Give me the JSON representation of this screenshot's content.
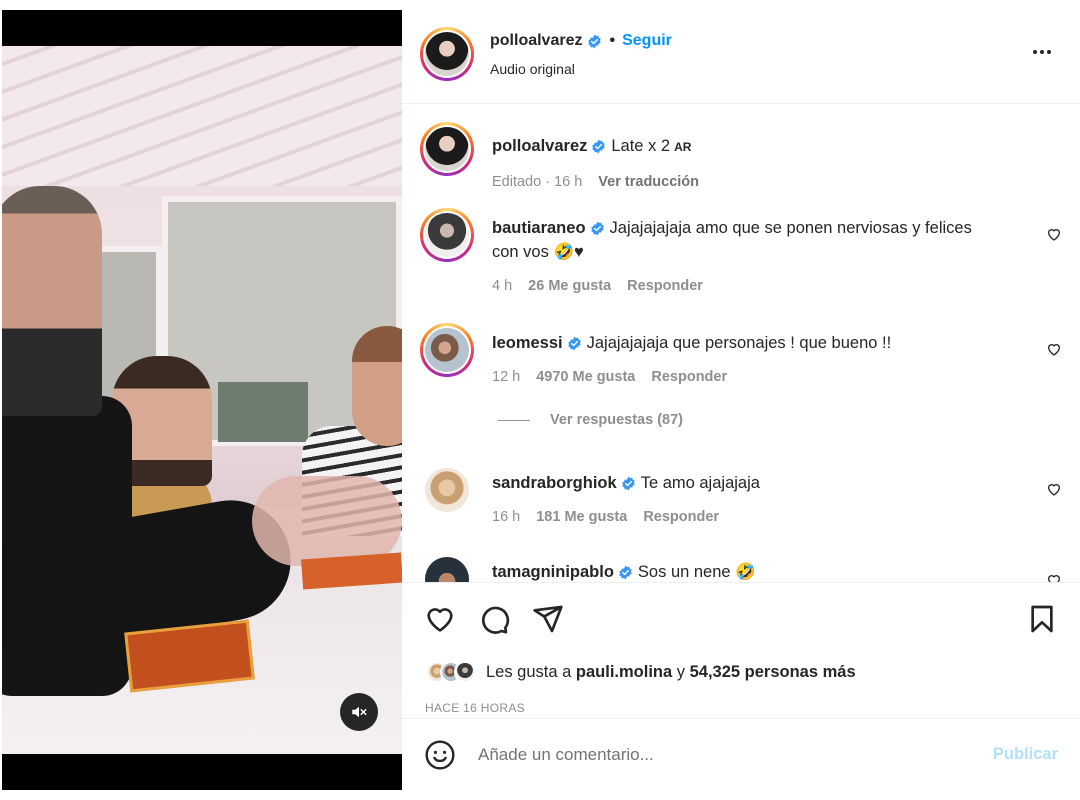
{
  "post": {
    "author": "polloalvarez",
    "follow_label": "Seguir",
    "separator": "•",
    "audio": "Audio original"
  },
  "caption": {
    "user": "polloalvarez",
    "text": "Late x 2",
    "tag": "AR",
    "edited": "Editado · 16 h",
    "translate": "Ver traducción"
  },
  "comments": [
    {
      "user": "bautiaraneo",
      "text": "Jajajajajaja amo que se ponen nerviosas y felices con vos 🤣♥",
      "time": "4 h",
      "likes": "26 Me gusta",
      "reply": "Responder"
    },
    {
      "user": "leomessi",
      "text": "Jajajajajaja que personajes ! que bueno !!",
      "time": "12 h",
      "likes": "4970 Me gusta",
      "reply": "Responder"
    },
    {
      "user": "sandraborghiok",
      "text": "Te amo ajajajaja",
      "time": "16 h",
      "likes": "181 Me gusta",
      "reply": "Responder"
    },
    {
      "user": "tamagninipablo",
      "text": "Sos un nene 🤣",
      "time": "",
      "likes": "",
      "reply": ""
    }
  ],
  "view_replies": "Ver respuestas (87)",
  "likes_summary": {
    "prefix": "Les gusta a",
    "user": "pauli.molina",
    "connector": "y",
    "others": "54,325 personas más"
  },
  "timestamp": "HACE 16 HORAS",
  "composer": {
    "placeholder": "Añade un comentario...",
    "publish": "Publicar"
  },
  "colors": {
    "accent": "#0095f6",
    "publish_disabled": "#b2dffc",
    "verified": "#3897f0",
    "muted_text": "#8e8e8e"
  },
  "icons": [
    "mute-icon",
    "verified-icon",
    "more-options-icon",
    "heart-icon",
    "comment-icon",
    "share-icon",
    "save-icon",
    "emoji-icon"
  ]
}
